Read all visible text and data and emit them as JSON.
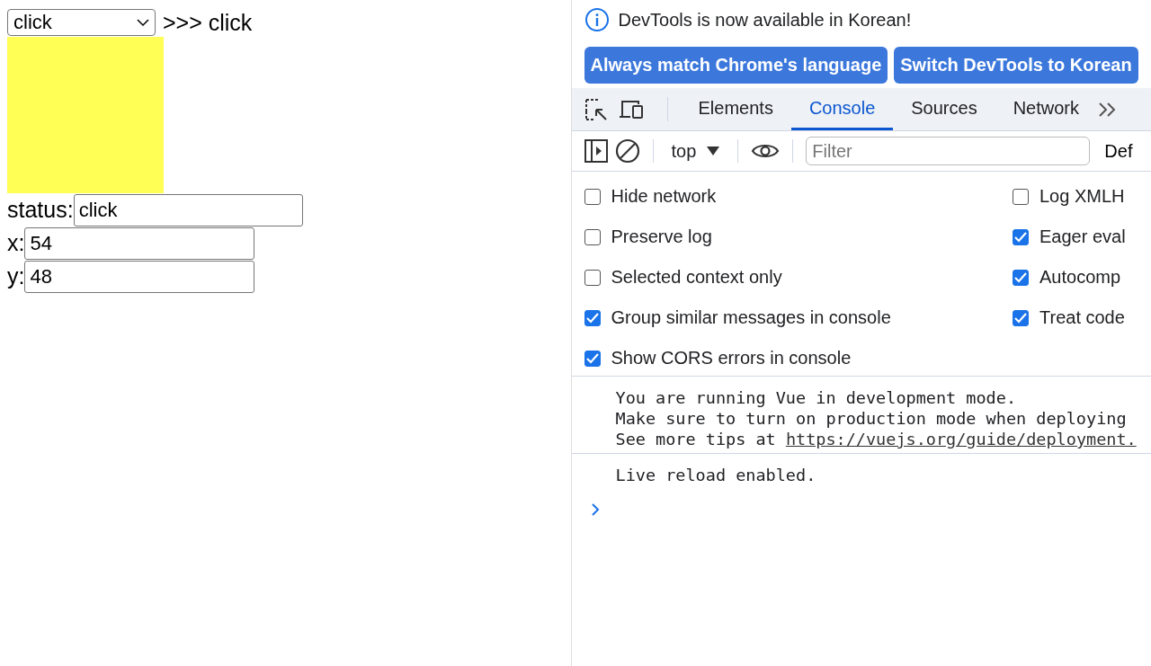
{
  "page": {
    "select": {
      "value": "click"
    },
    "echo": ">>> click",
    "fields": [
      {
        "label": "status:",
        "value": "click",
        "kind": "wide"
      },
      {
        "label": "x:",
        "value": "54",
        "kind": "narrow"
      },
      {
        "label": "y:",
        "value": "48",
        "kind": "narrow"
      }
    ]
  },
  "devtools": {
    "infobar": {
      "message": "DevTools is now available in Korean!"
    },
    "buttons": [
      "Always match Chrome's language",
      "Switch DevTools to Korean"
    ],
    "tabs": [
      {
        "label": "Elements",
        "selected": false
      },
      {
        "label": "Console",
        "selected": true
      },
      {
        "label": "Sources",
        "selected": false
      },
      {
        "label": "Network",
        "selected": false
      }
    ],
    "toolbar": {
      "context": "top",
      "filter": {
        "placeholder": "Filter"
      },
      "levels": "Def"
    },
    "settings": {
      "left": [
        {
          "label": "Hide network",
          "checked": false
        },
        {
          "label": "Preserve log",
          "checked": false
        },
        {
          "label": "Selected context only",
          "checked": false
        },
        {
          "label": "Group similar messages in console",
          "checked": true
        },
        {
          "label": "Show CORS errors in console",
          "checked": true
        }
      ],
      "right": [
        {
          "label": "Log XMLH",
          "checked": false
        },
        {
          "label": "Eager eval",
          "checked": true
        },
        {
          "label": "Autocomp",
          "checked": true
        },
        {
          "label": "Treat code",
          "checked": true
        }
      ]
    },
    "console": {
      "messages": [
        {
          "lines": [
            "You are running Vue in development mode.",
            "Make sure to turn on production mode when deploying"
          ],
          "link_prefix": "See more tips at ",
          "link": "https://vuejs.org/guide/deployment."
        },
        {
          "lines": [
            "Live reload enabled."
          ]
        }
      ]
    }
  }
}
